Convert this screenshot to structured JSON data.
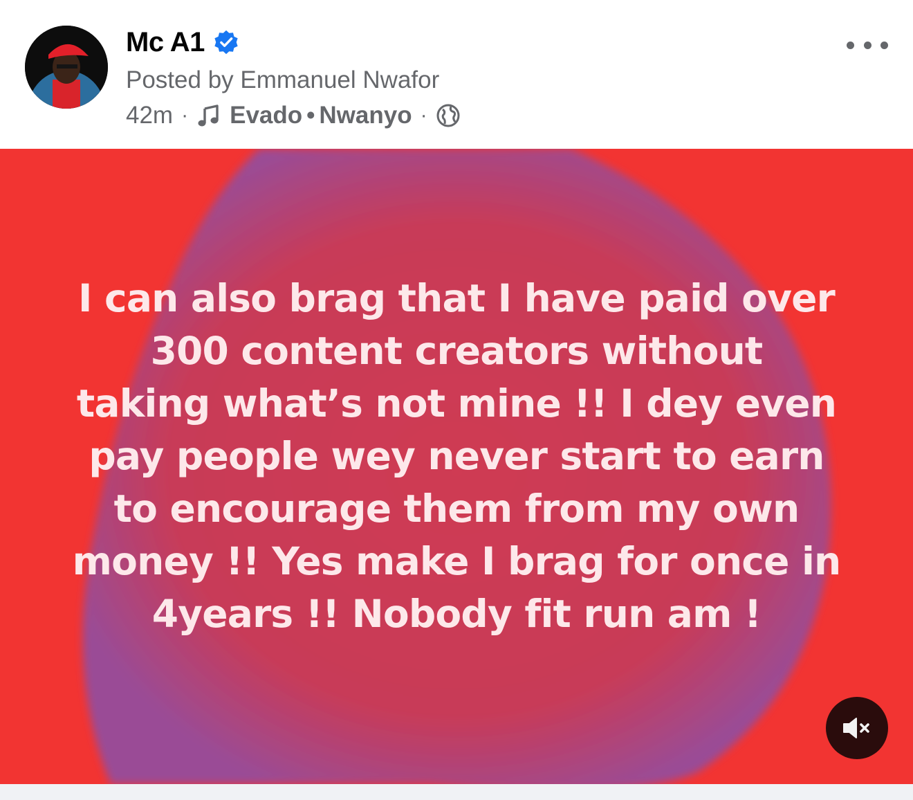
{
  "post": {
    "author": "Mc A1",
    "posted_by": "Posted by Emmanuel Nwafor",
    "time": "42m",
    "song_artist": "Evado",
    "song_separator": "•",
    "song_title": "Nwanyo",
    "meta_dot": "·",
    "audience_icon": "globe-icon",
    "text": "I can also brag that I have paid over\n300 content creators without\ntaking what’s not mine !! I dey even\npay people wey never start to earn\nto encourage them from my own\nmoney !! Yes make I brag for once in\n4years !!  Nobody fit run am !",
    "background_color": "#f23432",
    "text_color": "#fde8ea"
  },
  "icons": {
    "verified": "verified-badge-icon",
    "music": "music-note-icon",
    "more": "more-options-icon",
    "mute": "speaker-muted-icon"
  },
  "colors": {
    "verified_blue": "#1877f2",
    "secondary_text": "#65676b"
  }
}
